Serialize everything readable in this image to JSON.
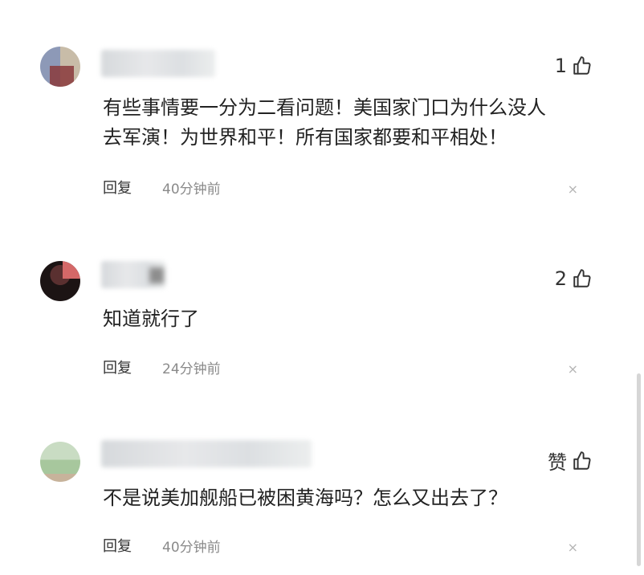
{
  "comments": [
    {
      "likes": "1",
      "text_lines": [
        "有些事情要一分为二看问题！美国家门口为什么没人",
        "去军演！为世界和平！所有国家都要和平相处！"
      ],
      "reply_label": "回复",
      "time": "40分钟前",
      "close": "×"
    },
    {
      "likes": "2",
      "text_lines": [
        "知道就行了"
      ],
      "reply_label": "回复",
      "time": "24分钟前",
      "close": "×"
    },
    {
      "likes": "赞",
      "text_lines": [
        "不是说美加舰船已被困黄海吗？怎么又出去了？"
      ],
      "reply_label": "回复",
      "time": "40分钟前",
      "close": "×"
    }
  ],
  "icons": {
    "like": "thumbs-up-icon",
    "dismiss": "close-icon"
  }
}
